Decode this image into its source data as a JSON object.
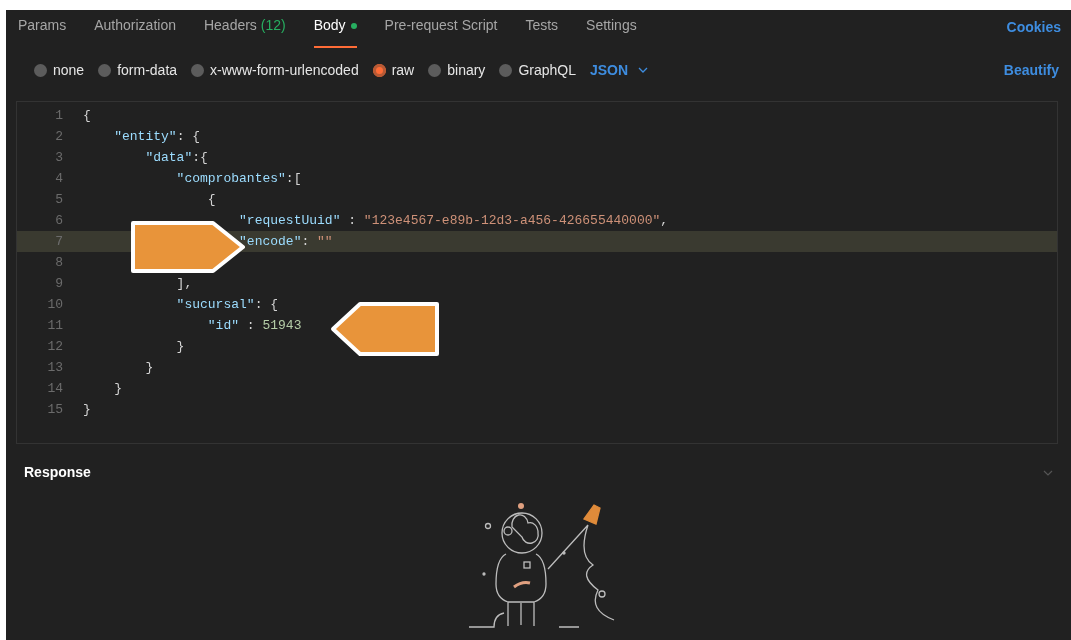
{
  "tabs": [
    {
      "label": "Params",
      "selected": false,
      "has_content": false
    },
    {
      "label": "Authorization",
      "selected": false,
      "has_content": false
    },
    {
      "label": "Headers",
      "count": "(12)",
      "selected": false,
      "has_content": false
    },
    {
      "label": "Body",
      "selected": true,
      "has_content": true
    },
    {
      "label": "Pre-request Script",
      "selected": false,
      "has_content": false
    },
    {
      "label": "Tests",
      "selected": false,
      "has_content": false
    },
    {
      "label": "Settings",
      "selected": false,
      "has_content": false
    }
  ],
  "cookies_link": "Cookies",
  "body_types": [
    {
      "label": "none",
      "selected": false
    },
    {
      "label": "form-data",
      "selected": false
    },
    {
      "label": "x-www-form-urlencoded",
      "selected": false
    },
    {
      "label": "raw",
      "selected": true
    },
    {
      "label": "binary",
      "selected": false
    },
    {
      "label": "GraphQL",
      "selected": false
    }
  ],
  "format_dropdown": "JSON",
  "beautify_link": "Beautify",
  "editor": {
    "lines": [
      {
        "number": "1",
        "highlighted": false,
        "tokens": [
          {
            "kind": "punct",
            "text": "{"
          }
        ]
      },
      {
        "number": "2",
        "highlighted": false,
        "tokens": [
          {
            "kind": "key",
            "text": "    \"entity\""
          },
          {
            "kind": "punct",
            "text": ": {"
          }
        ]
      },
      {
        "number": "3",
        "highlighted": false,
        "tokens": [
          {
            "kind": "key",
            "text": "        \"data\""
          },
          {
            "kind": "punct",
            "text": ":{"
          }
        ]
      },
      {
        "number": "4",
        "highlighted": false,
        "tokens": [
          {
            "kind": "key",
            "text": "            \"comprobantes\""
          },
          {
            "kind": "punct",
            "text": ":["
          }
        ]
      },
      {
        "number": "5",
        "highlighted": false,
        "tokens": [
          {
            "kind": "punct",
            "text": "                {"
          }
        ]
      },
      {
        "number": "6",
        "highlighted": false,
        "tokens": [
          {
            "kind": "key",
            "text": "                    \"requestUuid\""
          },
          {
            "kind": "punct",
            "text": " : "
          },
          {
            "kind": "string",
            "text": "\"123e4567-e89b-12d3-a456-426655440000\""
          },
          {
            "kind": "punct",
            "text": ","
          }
        ]
      },
      {
        "number": "7",
        "highlighted": true,
        "tokens": [
          {
            "kind": "key",
            "text": "                    \"encode\""
          },
          {
            "kind": "punct",
            "text": ": "
          },
          {
            "kind": "string",
            "text": "\"\""
          }
        ]
      },
      {
        "number": "8",
        "highlighted": false
      },
      {
        "number": "9",
        "highlighted": false,
        "tokens": [
          {
            "kind": "punct",
            "text": "            ],"
          }
        ]
      },
      {
        "number": "10",
        "highlighted": false,
        "tokens": [
          {
            "kind": "key",
            "text": "            \"sucursal\""
          },
          {
            "kind": "punct",
            "text": ": {"
          }
        ]
      },
      {
        "number": "11",
        "highlighted": false,
        "tokens": [
          {
            "kind": "key",
            "text": "                \"id\""
          },
          {
            "kind": "punct",
            "text": " : "
          },
          {
            "kind": "number",
            "text": "51943"
          }
        ]
      },
      {
        "number": "12",
        "highlighted": false,
        "tokens": [
          {
            "kind": "punct",
            "text": "            }"
          }
        ]
      },
      {
        "number": "13",
        "highlighted": false,
        "tokens": [
          {
            "kind": "punct",
            "text": "        }"
          }
        ]
      },
      {
        "number": "14",
        "highlighted": false,
        "tokens": [
          {
            "kind": "punct",
            "text": "    }"
          }
        ]
      },
      {
        "number": "15",
        "highlighted": false,
        "tokens": [
          {
            "kind": "punct",
            "text": "}"
          }
        ]
      }
    ]
  },
  "response": {
    "title": "Response"
  }
}
